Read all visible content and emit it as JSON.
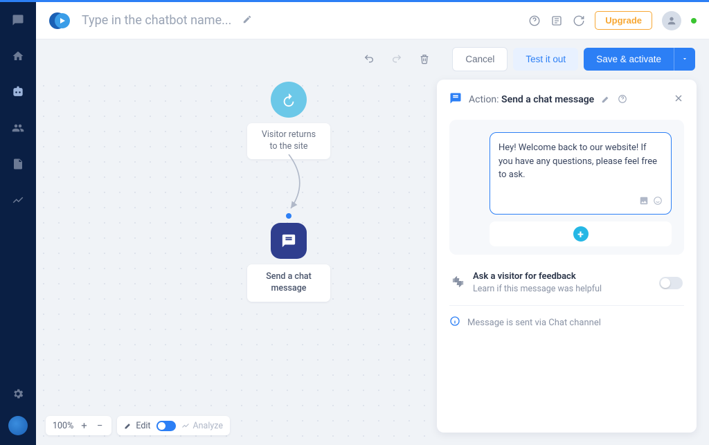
{
  "header": {
    "title_placeholder": "Type in the chatbot name...",
    "upgrade": "Upgrade"
  },
  "toolbar": {
    "cancel": "Cancel",
    "test": "Test it out",
    "save": "Save & activate"
  },
  "flow": {
    "trigger_label": "Visitor returns to the site",
    "action_label": "Send a chat message"
  },
  "panel": {
    "action_prefix": "Action: ",
    "action_name": "Send a chat message",
    "message_text": "Hey! Welcome back to our website! If you have any questions, please feel free to ask.",
    "feedback_title": "Ask a visitor for feedback",
    "feedback_sub": "Learn if this message was helpful",
    "info_text": "Message is sent via Chat channel"
  },
  "bottombar": {
    "zoom": "100%",
    "edit": "Edit",
    "analyze": "Analyze"
  }
}
